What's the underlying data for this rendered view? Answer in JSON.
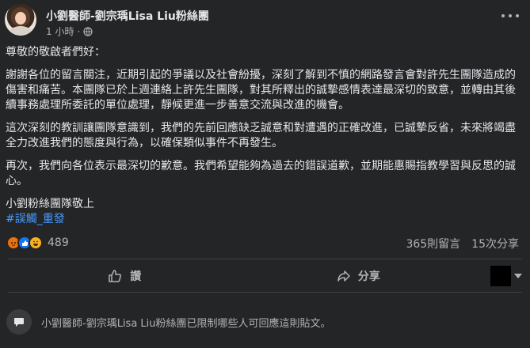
{
  "header": {
    "page_name": "小劉醫師-劉宗瑀Lisa Liu粉絲團",
    "timestamp": "1 小時",
    "separator": "·",
    "more_icon": "more-horizontal-icon",
    "privacy_icon": "globe-icon"
  },
  "body": {
    "greeting": "尊敬的敬啟者們好：",
    "paragraph1": "謝謝各位的留言關注，近期引起的爭議以及社會紛擾，深刻了解到不慎的網路發言會對許先生團隊造成的傷害和痛苦。本團隊已於上週連絡上許先生團隊，對其所釋出的誠摯感情表達最深切的致意，並轉由其後續事務處理所委託的單位處理，靜候更進一步善意交流與改進的機會。",
    "paragraph2": "這次深刻的教訓讓團隊意識到，我們的先前回應缺乏誠意和對遭遇的正確改進，已誠摯反省，未來將竭盡全力改進我們的態度與行為，以確保類似事件不再發生。",
    "paragraph3": "再次，我們向各位表示最深切的歉意。我們希望能夠為過去的錯誤道歉，並期能惠賜指教學習與反思的誠心。",
    "signature": "小劉粉絲團隊敬上",
    "hashtag": "#誤觸_重發"
  },
  "reactions": {
    "count": "489",
    "comments": "365則留言",
    "shares": "15次分享"
  },
  "actions": {
    "like_label": "讚",
    "share_label": "分享"
  },
  "restriction": {
    "text": "小劉醫師-劉宗瑀Lisa Liu粉絲團已限制哪些人可回應這則貼文。"
  },
  "colors": {
    "background": "#242526",
    "text": "#e4e6eb",
    "secondary": "#b0b3b8",
    "hashtag": "#4599ff"
  }
}
